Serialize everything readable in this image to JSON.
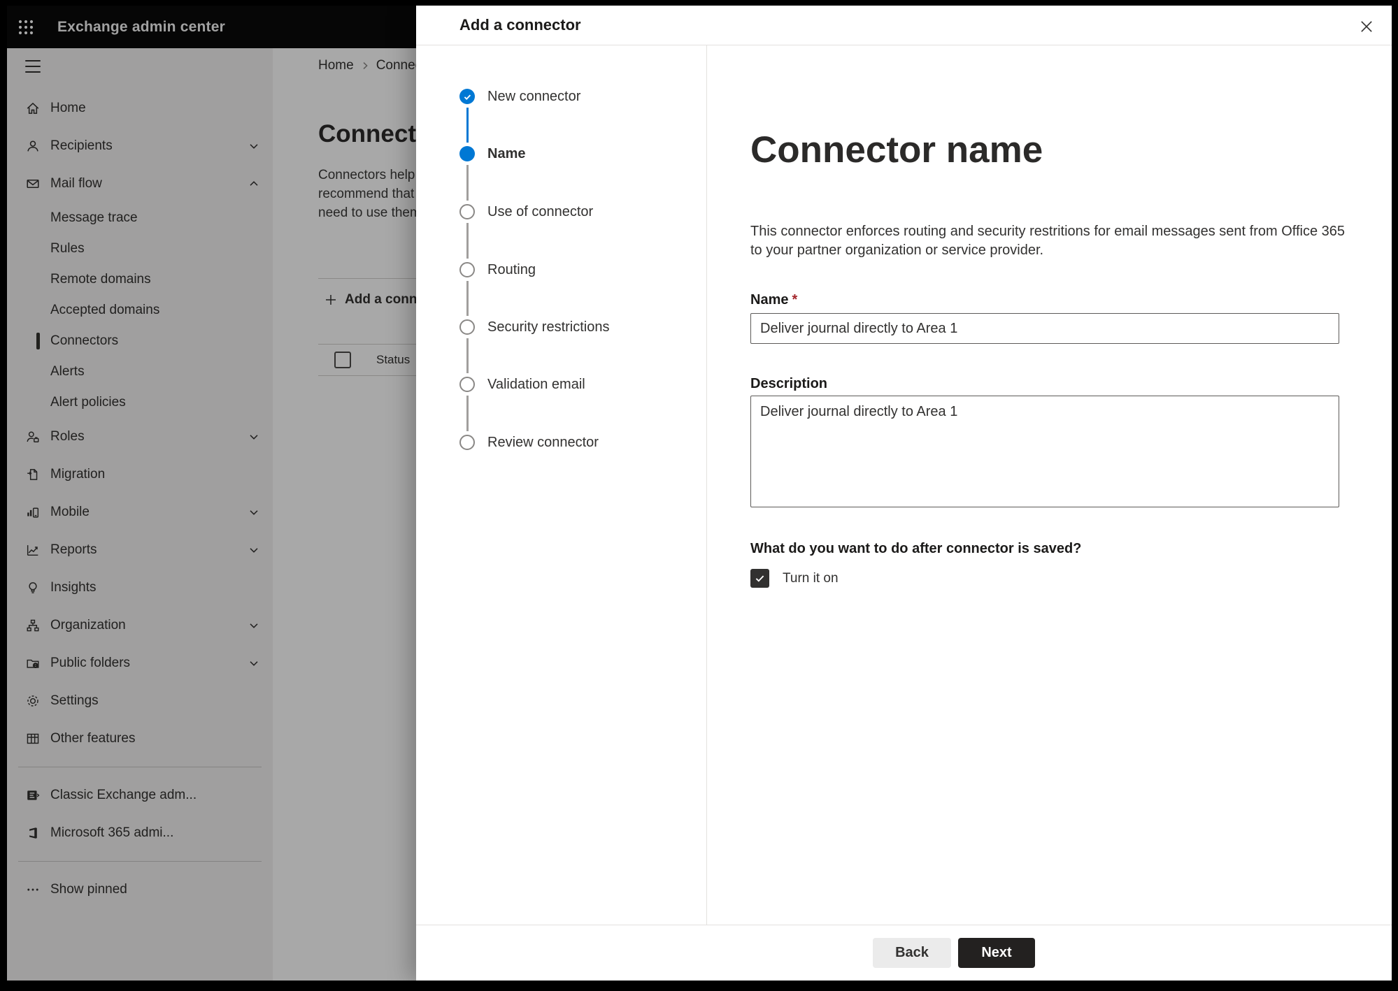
{
  "topbar": {
    "app_title": "Exchange admin center"
  },
  "sidebar": {
    "items": [
      {
        "label": "Home"
      },
      {
        "label": "Recipients"
      },
      {
        "label": "Mail flow"
      },
      {
        "label": "Message trace"
      },
      {
        "label": "Rules"
      },
      {
        "label": "Remote domains"
      },
      {
        "label": "Accepted domains"
      },
      {
        "label": "Connectors"
      },
      {
        "label": "Alerts"
      },
      {
        "label": "Alert policies"
      },
      {
        "label": "Roles"
      },
      {
        "label": "Migration"
      },
      {
        "label": "Mobile"
      },
      {
        "label": "Reports"
      },
      {
        "label": "Insights"
      },
      {
        "label": "Organization"
      },
      {
        "label": "Public folders"
      },
      {
        "label": "Settings"
      },
      {
        "label": "Other features"
      },
      {
        "label": "Classic Exchange adm..."
      },
      {
        "label": "Microsoft 365 admi..."
      },
      {
        "label": "Show pinned"
      }
    ]
  },
  "page": {
    "breadcrumb": {
      "home": "Home",
      "current": "Connectors"
    },
    "title": "Connectors",
    "intro": "Connectors help\nrecommend that\nneed to use them",
    "add_button_label": "Add a connector",
    "table": {
      "status_header": "Status"
    }
  },
  "modal": {
    "title": "Add a connector",
    "steps": [
      {
        "label": "New connector",
        "state": "done"
      },
      {
        "label": "Name",
        "state": "active"
      },
      {
        "label": "Use of connector",
        "state": "todo"
      },
      {
        "label": "Routing",
        "state": "todo"
      },
      {
        "label": "Security restrictions",
        "state": "todo"
      },
      {
        "label": "Validation email",
        "state": "todo"
      },
      {
        "label": "Review connector",
        "state": "todo"
      }
    ],
    "content": {
      "heading": "Connector name",
      "description": "This connector enforces routing and security restritions for email messages sent from Office 365\nto your partner organization or service provider.",
      "name_label": "Name",
      "required_mark": "*",
      "name_value": "Deliver journal directly to Area 1",
      "description_label": "Description",
      "description_value": "Deliver journal directly to Area 1",
      "after_save_question": "What do you want to do after connector is saved?",
      "turn_on_label": "Turn it on"
    },
    "footer": {
      "back_label": "Back",
      "next_label": "Next"
    }
  },
  "colors": {
    "accent_blue": "#0078d4",
    "topbar_black": "#0a0a0a",
    "sidebar_gray": "#f3f2f1",
    "primary_button": "#232120",
    "required_red": "#a4262c"
  }
}
